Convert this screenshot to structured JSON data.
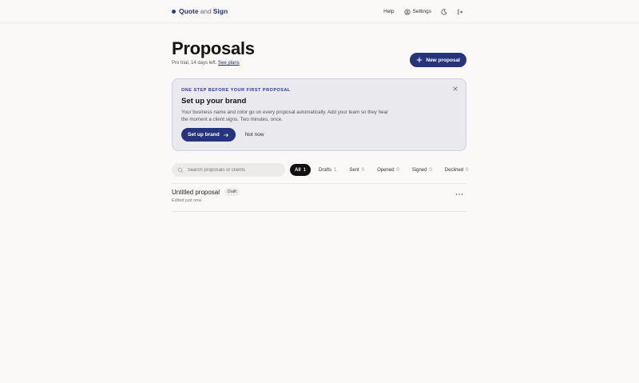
{
  "topbar": {
    "brand_part1": "Quote",
    "brand_part2": "and",
    "brand_part3": "Sign",
    "help": "Help",
    "settings": "Settings"
  },
  "header": {
    "title": "Proposals",
    "trial_text": "Pro trial, 14 days left.",
    "see_plans": "See plans",
    "new_button": "New proposal"
  },
  "brand_card": {
    "eyebrow": "ONE STEP BEFORE YOUR FIRST PROPOSAL",
    "title": "Set up your brand",
    "description": "Your business name and color go on every proposal automatically. Add your team so they hear the moment a client signs. Two minutes, once.",
    "primary_button": "Set up brand",
    "secondary_button": "Not now"
  },
  "search": {
    "placeholder": "Search proposals or clients",
    "value": ""
  },
  "filters": [
    {
      "label": "All",
      "count": "1",
      "active": true
    },
    {
      "label": "Drafts",
      "count": "1"
    },
    {
      "label": "Sent",
      "count": "0"
    },
    {
      "label": "Opened",
      "count": "0"
    },
    {
      "label": "Signed",
      "count": "0"
    },
    {
      "label": "Declined",
      "count": "0"
    }
  ],
  "proposals": [
    {
      "name": "Untitled proposal",
      "status": "Draft",
      "edited": "Edited just now"
    }
  ],
  "colors": {
    "accent": "#25347c",
    "background": "#faf9f8",
    "card_bg": "#e9e9ee"
  }
}
